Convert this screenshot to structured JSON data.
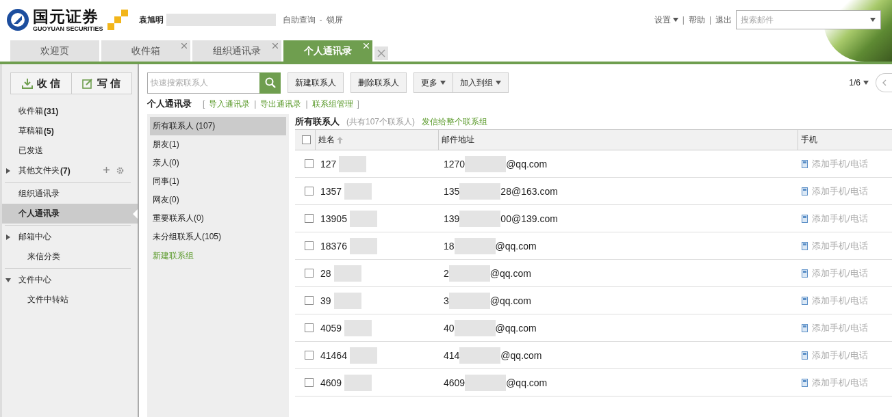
{
  "header": {
    "brand_cn": "国元证券",
    "brand_en": "GUOYUAN SECURITIES",
    "user": "袁旭明",
    "links": [
      "自助查询",
      "锁屏"
    ],
    "link_separator": "-",
    "top_links": [
      {
        "label": "设置",
        "dropdown": true
      },
      {
        "label": "帮助",
        "dropdown": false
      },
      {
        "label": "退出",
        "dropdown": false
      }
    ],
    "top_separator": "|",
    "search": {
      "placeholder": "搜索邮件"
    }
  },
  "tabs": [
    {
      "label": "欢迎页",
      "closable": false,
      "selected": false
    },
    {
      "label": "收件箱",
      "closable": true,
      "selected": false
    },
    {
      "label": "组织通讯录",
      "closable": true,
      "selected": false
    },
    {
      "label": "个人通讯录",
      "closable": true,
      "selected": true
    }
  ],
  "sidebar": {
    "buttons": [
      {
        "label": "收 信",
        "kind": "receive"
      },
      {
        "label": "写 信",
        "kind": "compose"
      }
    ],
    "sections": [
      [
        {
          "label": "收件箱",
          "count": "(31)",
          "selected": false
        },
        {
          "label": "草稿箱",
          "count": "(5)",
          "selected": false
        },
        {
          "label": "已发送",
          "selected": false
        },
        {
          "label": "其他文件夹",
          "count": "(7)",
          "expanded": false,
          "tools": true,
          "selected": false
        }
      ],
      [
        {
          "label": "组织通讯录",
          "selected": false
        },
        {
          "label": "个人通讯录",
          "selected": true
        }
      ],
      [
        {
          "label": "邮箱中心",
          "expanded": false,
          "selected": false,
          "children": [
            {
              "label": "来信分类",
              "selected": false
            }
          ]
        }
      ],
      [
        {
          "label": "文件中心",
          "expanded": true,
          "selected": false,
          "children": [
            {
              "label": "文件中转站",
              "selected": false
            }
          ]
        }
      ]
    ]
  },
  "toolbar": {
    "search": {
      "placeholder": "快速搜索联系人"
    },
    "buttons": [
      "新建联系人",
      "删除联系人"
    ],
    "dropdowns": [
      "更多",
      "加入到组"
    ],
    "pager": "1/6"
  },
  "book": {
    "title": "个人通讯录",
    "brackets": [
      "[",
      "]"
    ],
    "separator": "|",
    "links": [
      "导入通讯录",
      "导出通讯录",
      "联系组管理"
    ]
  },
  "groups": [
    {
      "label": "所有联系人 (107)",
      "selected": true
    },
    {
      "label": "朋友(1)",
      "selected": false
    },
    {
      "label": "亲人(0)",
      "selected": false
    },
    {
      "label": "同事(1)",
      "selected": false
    },
    {
      "label": "网友(0)",
      "selected": false
    },
    {
      "label": "重要联系人(0)",
      "selected": false
    },
    {
      "label": "未分组联系人(105)",
      "selected": false
    }
  ],
  "new_group": "新建联系组",
  "list": {
    "select_all_checked": false,
    "title": "所有联系人",
    "count": "(共有107个联系人)",
    "send_link": "发信给整个联系组",
    "columns": [
      {
        "label": "姓名",
        "sorted": true
      },
      {
        "label": "邮件地址",
        "sorted": false
      },
      {
        "label": "手机",
        "sorted": false
      }
    ],
    "rows": [
      {
        "checked": false,
        "name": "127",
        "email_start": "1270",
        "email_end": "@qq.com",
        "phone": "添加手机/电话"
      },
      {
        "checked": false,
        "name": "1357",
        "email_start": "135",
        "email_end": "28@163.com",
        "phone": "添加手机/电话"
      },
      {
        "checked": false,
        "name": "13905",
        "email_start": "139",
        "email_end": "00@139.com",
        "phone": "添加手机/电话"
      },
      {
        "checked": false,
        "name": "18376",
        "email_start": "18",
        "email_end": "@qq.com",
        "phone": "添加手机/电话"
      },
      {
        "checked": false,
        "name": "28",
        "email_start": "2",
        "email_end": "@qq.com",
        "phone": "添加手机/电话"
      },
      {
        "checked": false,
        "name": "39",
        "email_start": "3",
        "email_end": "@qq.com",
        "phone": "添加手机/电话"
      },
      {
        "checked": false,
        "name": "4059",
        "email_start": "40",
        "email_end": "@qq.com",
        "phone": "添加手机/电话"
      },
      {
        "checked": false,
        "name": "41464",
        "email_start": "414",
        "email_end": "@qq.com",
        "phone": "添加手机/电话"
      },
      {
        "checked": false,
        "name": "4609",
        "email_start": "4609",
        "email_end": "@qq.com",
        "phone": "添加手机/电话"
      }
    ]
  }
}
